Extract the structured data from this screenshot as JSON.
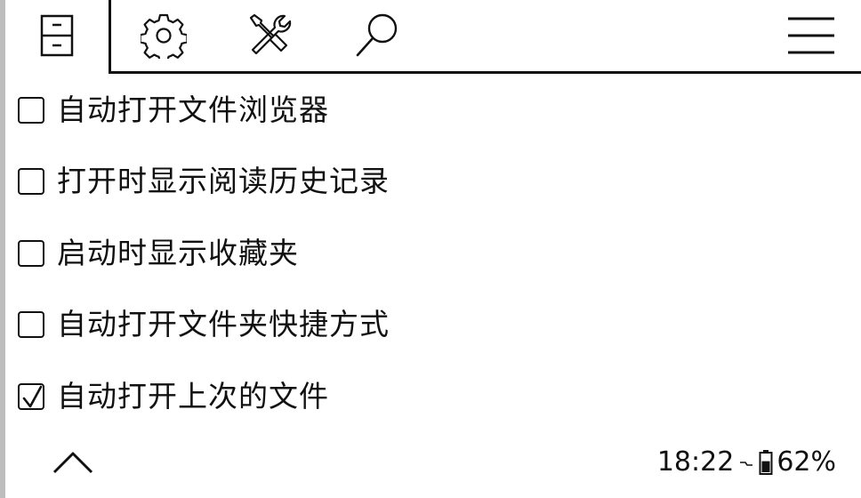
{
  "toolbar": {
    "tabs": [
      {
        "icon": "file-cabinet-icon",
        "selected": true
      },
      {
        "icon": "gear-icon",
        "selected": false
      },
      {
        "icon": "tools-icon",
        "selected": false
      },
      {
        "icon": "search-icon",
        "selected": false
      }
    ],
    "menu_icon": "hamburger-menu-icon"
  },
  "settings": {
    "items": [
      {
        "label": "自动打开文件浏览器",
        "checked": false
      },
      {
        "label": "打开时显示阅读历史记录",
        "checked": false
      },
      {
        "label": "启动时显示收藏夹",
        "checked": false
      },
      {
        "label": "自动打开文件夹快捷方式",
        "checked": false
      },
      {
        "label": "自动打开上次的文件",
        "checked": true
      }
    ]
  },
  "footer": {
    "scroll_icon": "chevron-up-icon",
    "clock": "18:22",
    "battery_percent": "62%",
    "battery_level": 0.62,
    "charging_icon": "charging-icon"
  }
}
